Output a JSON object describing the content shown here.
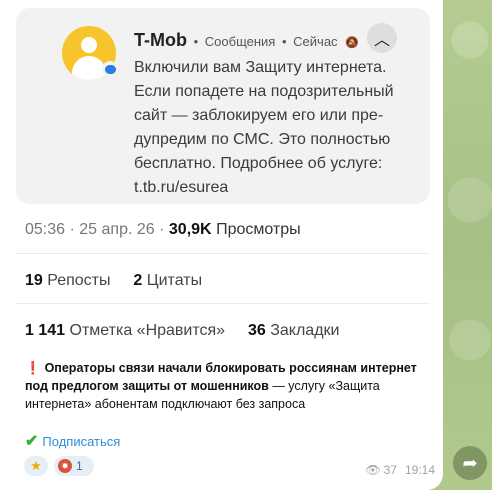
{
  "notification": {
    "app_name": "T-Mob",
    "category": "Сообщения",
    "time": "Сейчас",
    "bell_icon": "bell-muted-icon",
    "collapse_icon": "chevron-up-icon",
    "body": "Включили вам Защиту интернета.\nЕсли попадете на подозрительный\nсайт — заблокируем его или пре-\nдупредим по СМС. Это полностью\nбесплатно. Подробнее об услуге:\nt.tb.ru/esurea"
  },
  "post_stats": {
    "time": "05:36",
    "date": "25 апр. 26",
    "views_count": "30,9K",
    "views_label": "Просмотры",
    "reposts_count": "19",
    "reposts_label": "Репосты",
    "quotes_count": "2",
    "quotes_label": "Цитаты",
    "likes_count": "1 141",
    "likes_label": "Отметка «Нравится»",
    "bookmarks_count": "36",
    "bookmarks_label": "Закладки"
  },
  "headline": {
    "icon": "exclamation-icon",
    "bold_text": "Операторы связи начали блокировать россиянам интернет под предлогом защиты от мошенников",
    "rest_text": " — услугу «Защита интернета» абонентам подключают без запроса"
  },
  "subscribe": {
    "icon": "checkmark-icon",
    "label": "Подписаться"
  },
  "reactions": [
    {
      "icon": "star-icon",
      "count": ""
    },
    {
      "icon": "fire-avatar-icon",
      "count": "1"
    }
  ],
  "meta": {
    "views": "37",
    "time": "19:14"
  },
  "colors": {
    "accent": "#2b8fd6",
    "avatar": "#f7c52b",
    "check": "#34b034",
    "alert": "#d42a2a"
  }
}
